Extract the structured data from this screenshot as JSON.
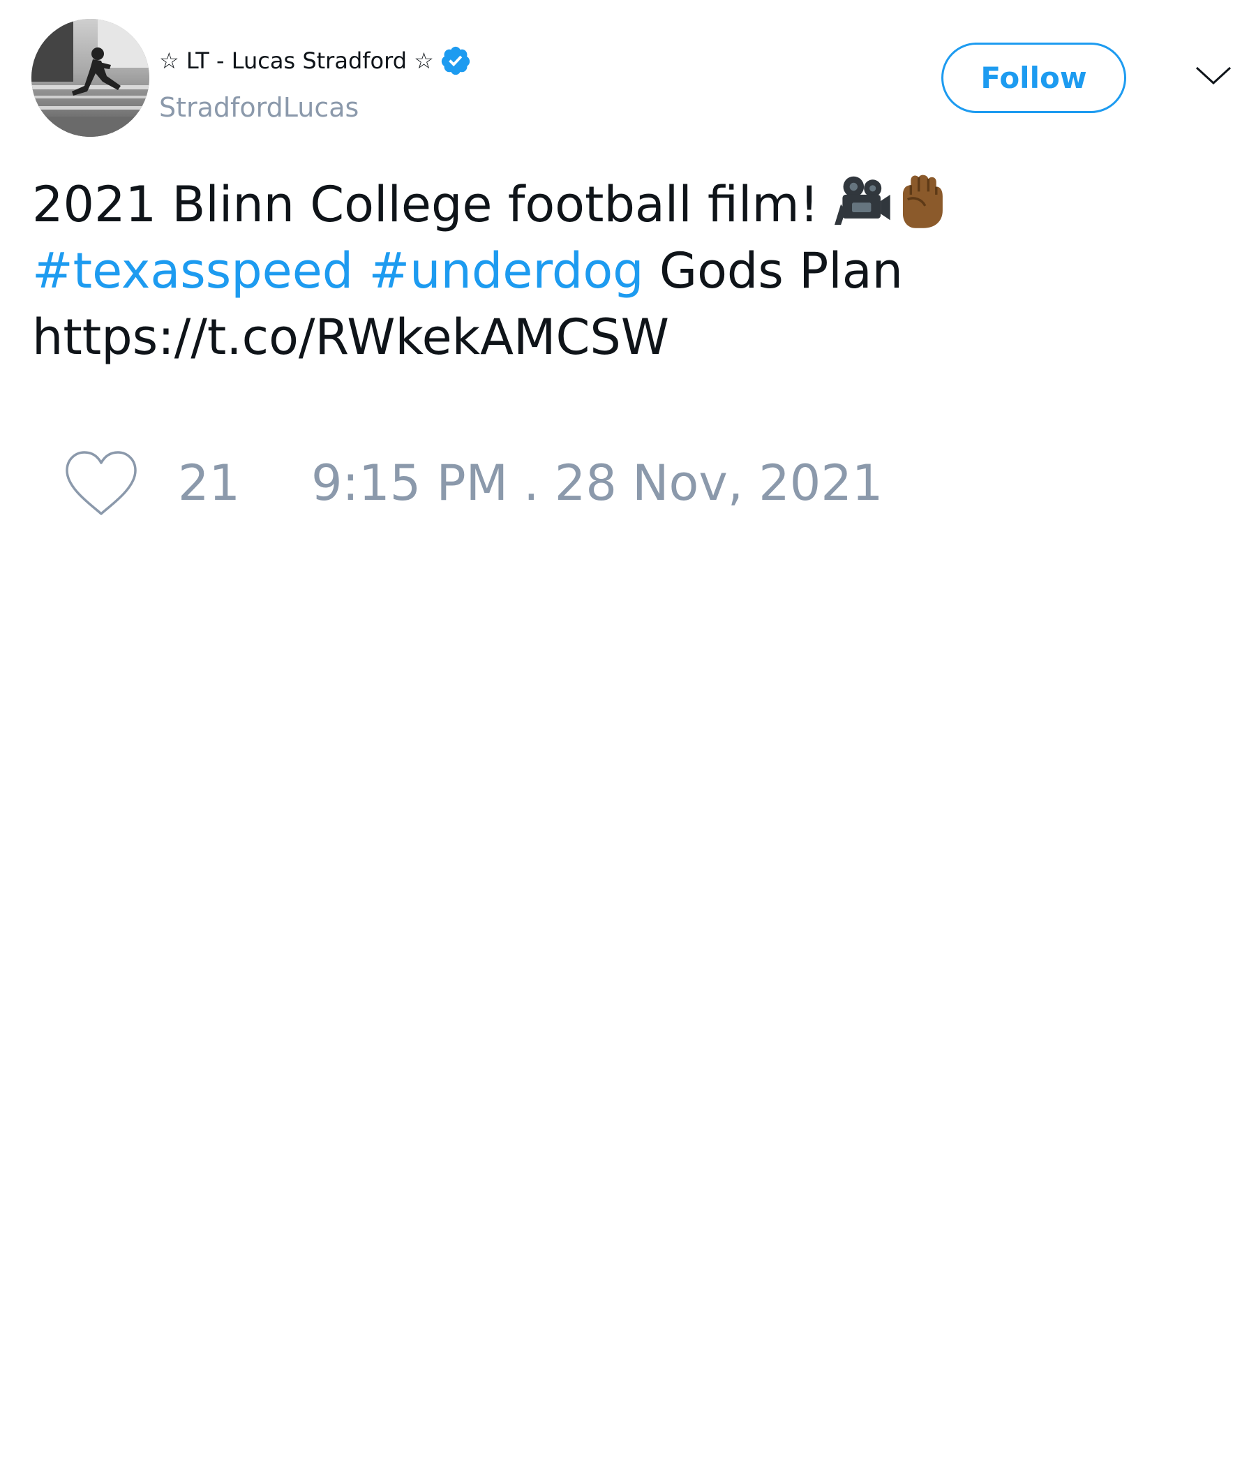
{
  "tweet": {
    "author": {
      "display_name": "☆ LT - Lucas Stradford ☆",
      "handle": "StradfordLucas",
      "verified": true,
      "avatar_icon": "profile-photo-sprinter"
    },
    "follow_label": "Follow",
    "more_icon": "chevron-down-icon",
    "text": {
      "line1": "2021 Blinn College football film! ",
      "emojis": [
        "movie-camera-icon",
        "raised-fist-icon"
      ],
      "hashtag1": "#texasspeed",
      "hashtag2": "#underdog",
      "line2_rest": " Gods Plan",
      "link": "https://t.co/RWkekAMCSW"
    },
    "like_count": "21",
    "timestamp": "9:15 PM . 28 Nov, 2021"
  },
  "colors": {
    "accent": "#1d9bf0",
    "muted": "#8b99ab",
    "text": "#0f1419"
  }
}
